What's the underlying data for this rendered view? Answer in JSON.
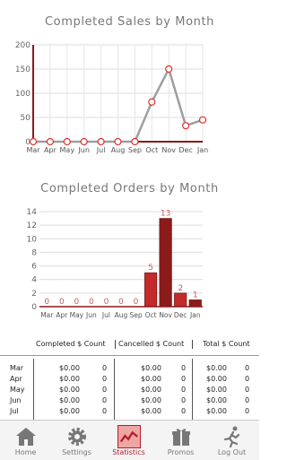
{
  "sales_chart_title": "Completed Sales by Month",
  "orders_chart_title": "Completed Orders by Month",
  "chart_data": [
    {
      "type": "line",
      "title": "Completed Sales by Month",
      "categories": [
        "Mar",
        "Apr",
        "May",
        "Jun",
        "Jul",
        "Aug",
        "Sep",
        "Oct",
        "Nov",
        "Dec",
        "Jan"
      ],
      "values": [
        0,
        0,
        0,
        0,
        0,
        0,
        0,
        82,
        150,
        33,
        45
      ],
      "ylim": [
        0,
        200
      ],
      "yticks": [
        "0",
        "50",
        "100",
        "150",
        "200"
      ],
      "colors": {
        "line": "#9e9e9e",
        "marker": "#e03030",
        "axis": "#8b1a1a"
      }
    },
    {
      "type": "bar",
      "title": "Completed Orders by Month",
      "categories": [
        "Mar",
        "Apr",
        "May",
        "Jun",
        "Jul",
        "Aug",
        "Sep",
        "Oct",
        "Nov",
        "Dec",
        "Jan"
      ],
      "values": [
        0,
        0,
        0,
        0,
        0,
        0,
        0,
        5,
        13,
        2,
        1
      ],
      "ylim": [
        0,
        14
      ],
      "yticks": [
        "0",
        "2",
        "4",
        "6",
        "8",
        "10",
        "12",
        "14"
      ],
      "colors": {
        "bar_dark": "#8b1a1a",
        "bar_light": "#c42a2a",
        "label": "#c06060"
      }
    }
  ],
  "table": {
    "headers": [
      "Completed $ Count",
      "Cancelled $ Count",
      "Total $ Count"
    ],
    "rows": [
      {
        "month": "Mar",
        "completed_amt": "$0.00",
        "completed_cnt": "0",
        "cancelled_amt": "$0.00",
        "cancelled_cnt": "0",
        "total_amt": "$0.00",
        "total_cnt": "0"
      },
      {
        "month": "Apr",
        "completed_amt": "$0.00",
        "completed_cnt": "0",
        "cancelled_amt": "$0.00",
        "cancelled_cnt": "0",
        "total_amt": "$0.00",
        "total_cnt": "0"
      },
      {
        "month": "May",
        "completed_amt": "$0.00",
        "completed_cnt": "0",
        "cancelled_amt": "$0.00",
        "cancelled_cnt": "0",
        "total_amt": "$0.00",
        "total_cnt": "0"
      },
      {
        "month": "Jun",
        "completed_amt": "$0.00",
        "completed_cnt": "0",
        "cancelled_amt": "$0.00",
        "cancelled_cnt": "0",
        "total_amt": "$0.00",
        "total_cnt": "0"
      },
      {
        "month": "Jul",
        "completed_amt": "$0.00",
        "completed_cnt": "0",
        "cancelled_amt": "$0.00",
        "cancelled_cnt": "0",
        "total_amt": "$0.00",
        "total_cnt": "0"
      }
    ]
  },
  "tabs": [
    {
      "label": "Home",
      "icon": "house-icon",
      "active": false
    },
    {
      "label": "Settings",
      "icon": "gear-icon",
      "active": false
    },
    {
      "label": "Statistics",
      "icon": "chart-line-icon",
      "active": true
    },
    {
      "label": "Promos",
      "icon": "gift-icon",
      "active": false
    },
    {
      "label": "Log Out",
      "icon": "running-man-icon",
      "active": false
    }
  ]
}
